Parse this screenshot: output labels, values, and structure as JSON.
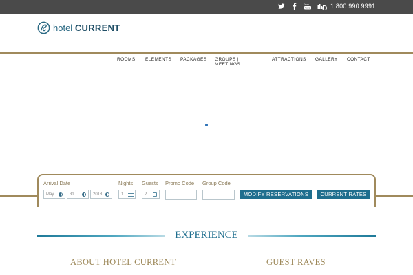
{
  "topbar": {
    "social_icons": [
      "twitter-icon",
      "facebook-icon",
      "youtube-icon",
      "tripadvisor-icon"
    ],
    "phone": "1.800.990.9991"
  },
  "logo": {
    "light": "hotel",
    "bold": "CURRENT"
  },
  "nav": {
    "items": [
      {
        "label": "ROOMS"
      },
      {
        "label": "ELEMENTS"
      },
      {
        "label": "PACKAGES"
      },
      {
        "label": "GROUPS | MEETINGS"
      },
      {
        "label": "ATTRACTIONS"
      },
      {
        "label": "GALLERY"
      },
      {
        "label": "CONTACT"
      }
    ]
  },
  "booking": {
    "arrival_label": "Arrival Date",
    "month": "May",
    "day": "31",
    "year": "2018",
    "nights_label": "Nights",
    "nights": "1",
    "guests_label": "Guests",
    "guests": "2",
    "promo_label": "Promo Code",
    "group_label": "Group Code",
    "modify_label": "MODIFY RESERVATIONS",
    "rates_label": "CURRENT RATES"
  },
  "experience": {
    "title": "EXPERIENCE",
    "about": "ABOUT HOTEL CURRENT",
    "raves": "GUEST RAVES"
  },
  "colors": {
    "topbar": "#4a4a4a",
    "gold": "#a08a5c",
    "brand_blue": "#1f6e8e"
  }
}
